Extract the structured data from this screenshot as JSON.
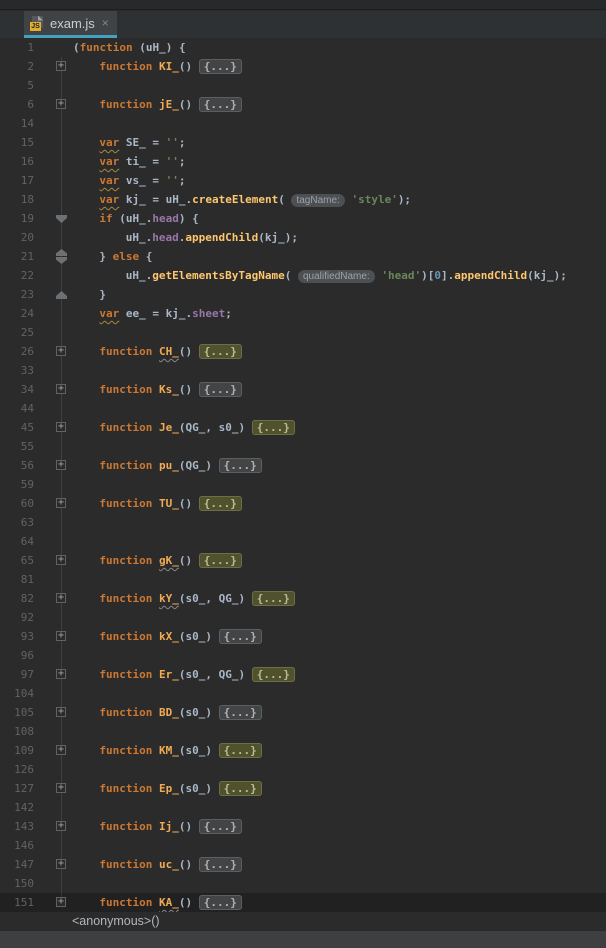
{
  "tab": {
    "title": "exam.js",
    "close_glyph": "×",
    "icon": "js-file-icon",
    "accent_color": "#45a0bd"
  },
  "breadcrumb": {
    "label": "<anonymous>()"
  },
  "colors": {
    "editor_bg": "#2b2b2b",
    "keyword": "#cc7832",
    "function_name": "#f0ab54",
    "method_call": "#ffc66d",
    "string": "#6a8759",
    "number": "#6897bb",
    "field": "#9876aa",
    "fold_highlight_bg": "#4f522d",
    "gutter_text": "#606366"
  },
  "rows": [
    {
      "n": "1",
      "indent": 0,
      "marker": null,
      "segs": [
        [
          "pl",
          "("
        ],
        [
          "kw",
          "function"
        ],
        [
          "pl",
          " (uH_) {"
        ]
      ]
    },
    {
      "n": "2",
      "indent": 4,
      "marker": "plus",
      "segs": [
        [
          "kw",
          "function"
        ],
        [
          "pl",
          " "
        ],
        [
          "fn",
          "KI_"
        ],
        [
          "pl",
          "() "
        ],
        [
          "foldg",
          "{...}"
        ]
      ]
    },
    {
      "n": "5",
      "indent": 0,
      "marker": null,
      "segs": []
    },
    {
      "n": "6",
      "indent": 4,
      "marker": "plus",
      "segs": [
        [
          "kw",
          "function"
        ],
        [
          "pl",
          " "
        ],
        [
          "fn",
          "jE_"
        ],
        [
          "pl",
          "() "
        ],
        [
          "foldg",
          "{...}"
        ]
      ]
    },
    {
      "n": "14",
      "indent": 0,
      "marker": null,
      "segs": []
    },
    {
      "n": "15",
      "indent": 4,
      "marker": null,
      "segs": [
        [
          "kwW",
          "var"
        ],
        [
          "pl",
          " SE_ = "
        ],
        [
          "str",
          "''"
        ],
        [
          "pl",
          ";"
        ]
      ]
    },
    {
      "n": "16",
      "indent": 4,
      "marker": null,
      "segs": [
        [
          "kwW",
          "var"
        ],
        [
          "pl",
          " ti_ = "
        ],
        [
          "str",
          "''"
        ],
        [
          "pl",
          ";"
        ]
      ]
    },
    {
      "n": "17",
      "indent": 4,
      "marker": null,
      "segs": [
        [
          "kwW",
          "var"
        ],
        [
          "pl",
          " vs_ = "
        ],
        [
          "str",
          "''"
        ],
        [
          "pl",
          ";"
        ]
      ]
    },
    {
      "n": "18",
      "indent": 4,
      "marker": null,
      "segs": [
        [
          "kwW",
          "var"
        ],
        [
          "pl",
          " kj_ = uH_."
        ],
        [
          "call",
          "createElement"
        ],
        [
          "pl",
          "( "
        ],
        [
          "hint",
          "tagName:"
        ],
        [
          "pl",
          " "
        ],
        [
          "str",
          "'style'"
        ],
        [
          "pl",
          ");"
        ]
      ]
    },
    {
      "n": "19",
      "indent": 4,
      "marker": "down",
      "segs": [
        [
          "kw",
          "if"
        ],
        [
          "pl",
          " (uH_."
        ],
        [
          "field",
          "head"
        ],
        [
          "pl",
          ") {"
        ]
      ]
    },
    {
      "n": "20",
      "indent": 8,
      "marker": null,
      "segs": [
        [
          "pl",
          "uH_."
        ],
        [
          "field",
          "head"
        ],
        [
          "pl",
          "."
        ],
        [
          "call",
          "appendChild"
        ],
        [
          "pl",
          "(kj_);"
        ]
      ]
    },
    {
      "n": "21",
      "indent": 4,
      "marker": "both",
      "segs": [
        [
          "pl",
          "} "
        ],
        [
          "kw",
          "else"
        ],
        [
          "pl",
          " {"
        ]
      ]
    },
    {
      "n": "22",
      "indent": 8,
      "marker": null,
      "segs": [
        [
          "pl",
          "uH_."
        ],
        [
          "call",
          "getElementsByTagName"
        ],
        [
          "pl",
          "( "
        ],
        [
          "hint",
          "qualifiedName:"
        ],
        [
          "pl",
          " "
        ],
        [
          "str",
          "'head'"
        ],
        [
          "pl",
          ")["
        ],
        [
          "num",
          "0"
        ],
        [
          "pl",
          "]."
        ],
        [
          "call",
          "appendChild"
        ],
        [
          "pl",
          "(kj_);"
        ]
      ]
    },
    {
      "n": "23",
      "indent": 4,
      "marker": "up",
      "segs": [
        [
          "pl",
          "}"
        ]
      ]
    },
    {
      "n": "24",
      "indent": 4,
      "marker": null,
      "segs": [
        [
          "kwW",
          "var"
        ],
        [
          "pl",
          " ee_ = kj_."
        ],
        [
          "field",
          "sheet"
        ],
        [
          "pl",
          ";"
        ]
      ]
    },
    {
      "n": "25",
      "indent": 0,
      "marker": null,
      "segs": []
    },
    {
      "n": "26",
      "indent": 4,
      "marker": "plus",
      "segs": [
        [
          "kw",
          "function"
        ],
        [
          "pl",
          " "
        ],
        [
          "fnW",
          "CH_"
        ],
        [
          "pl",
          "() "
        ],
        [
          "foldo",
          "{...}"
        ]
      ]
    },
    {
      "n": "33",
      "indent": 0,
      "marker": null,
      "segs": []
    },
    {
      "n": "34",
      "indent": 4,
      "marker": "plus",
      "segs": [
        [
          "kw",
          "function"
        ],
        [
          "pl",
          " "
        ],
        [
          "fn",
          "Ks_"
        ],
        [
          "pl",
          "() "
        ],
        [
          "foldg",
          "{...}"
        ]
      ]
    },
    {
      "n": "44",
      "indent": 0,
      "marker": null,
      "segs": []
    },
    {
      "n": "45",
      "indent": 4,
      "marker": "plus",
      "segs": [
        [
          "kw",
          "function"
        ],
        [
          "pl",
          " "
        ],
        [
          "fn",
          "Je_"
        ],
        [
          "pl",
          "(QG_, s0_) "
        ],
        [
          "foldo",
          "{...}"
        ]
      ]
    },
    {
      "n": "55",
      "indent": 0,
      "marker": null,
      "segs": []
    },
    {
      "n": "56",
      "indent": 4,
      "marker": "plus",
      "segs": [
        [
          "kw",
          "function"
        ],
        [
          "pl",
          " "
        ],
        [
          "fn",
          "pu_"
        ],
        [
          "pl",
          "(QG_) "
        ],
        [
          "foldg",
          "{...}"
        ]
      ]
    },
    {
      "n": "59",
      "indent": 0,
      "marker": null,
      "segs": []
    },
    {
      "n": "60",
      "indent": 4,
      "marker": "plus",
      "segs": [
        [
          "kw",
          "function"
        ],
        [
          "pl",
          " "
        ],
        [
          "fn",
          "TU_"
        ],
        [
          "pl",
          "() "
        ],
        [
          "foldo",
          "{...}"
        ]
      ]
    },
    {
      "n": "63",
      "indent": 0,
      "marker": null,
      "segs": []
    },
    {
      "n": "64",
      "indent": 0,
      "marker": null,
      "segs": []
    },
    {
      "n": "65",
      "indent": 4,
      "marker": "plus",
      "segs": [
        [
          "kw",
          "function"
        ],
        [
          "pl",
          " "
        ],
        [
          "fnW",
          "gK_"
        ],
        [
          "pl",
          "() "
        ],
        [
          "foldo",
          "{...}"
        ]
      ]
    },
    {
      "n": "81",
      "indent": 0,
      "marker": null,
      "segs": []
    },
    {
      "n": "82",
      "indent": 4,
      "marker": "plus",
      "segs": [
        [
          "kw",
          "function"
        ],
        [
          "pl",
          " "
        ],
        [
          "fnW",
          "kY_"
        ],
        [
          "pl",
          "(s0_, QG_) "
        ],
        [
          "foldo",
          "{...}"
        ]
      ]
    },
    {
      "n": "92",
      "indent": 0,
      "marker": null,
      "segs": []
    },
    {
      "n": "93",
      "indent": 4,
      "marker": "plus",
      "segs": [
        [
          "kw",
          "function"
        ],
        [
          "pl",
          " "
        ],
        [
          "fn",
          "kX_"
        ],
        [
          "pl",
          "(s0_) "
        ],
        [
          "foldg",
          "{...}"
        ]
      ]
    },
    {
      "n": "96",
      "indent": 0,
      "marker": null,
      "segs": []
    },
    {
      "n": "97",
      "indent": 4,
      "marker": "plus",
      "segs": [
        [
          "kw",
          "function"
        ],
        [
          "pl",
          " "
        ],
        [
          "fn",
          "Er_"
        ],
        [
          "pl",
          "(s0_, QG_) "
        ],
        [
          "foldo",
          "{...}"
        ]
      ]
    },
    {
      "n": "104",
      "indent": 0,
      "marker": null,
      "segs": []
    },
    {
      "n": "105",
      "indent": 4,
      "marker": "plus",
      "segs": [
        [
          "kw",
          "function"
        ],
        [
          "pl",
          " "
        ],
        [
          "fn",
          "BD_"
        ],
        [
          "pl",
          "(s0_) "
        ],
        [
          "foldg",
          "{...}"
        ]
      ]
    },
    {
      "n": "108",
      "indent": 0,
      "marker": null,
      "segs": []
    },
    {
      "n": "109",
      "indent": 4,
      "marker": "plus",
      "segs": [
        [
          "kw",
          "function"
        ],
        [
          "pl",
          " "
        ],
        [
          "fn",
          "KM_"
        ],
        [
          "pl",
          "(s0_) "
        ],
        [
          "foldo",
          "{...}"
        ]
      ]
    },
    {
      "n": "126",
      "indent": 0,
      "marker": null,
      "segs": []
    },
    {
      "n": "127",
      "indent": 4,
      "marker": "plus",
      "segs": [
        [
          "kw",
          "function"
        ],
        [
          "pl",
          " "
        ],
        [
          "fn",
          "Ep_"
        ],
        [
          "pl",
          "(s0_) "
        ],
        [
          "foldo",
          "{...}"
        ]
      ]
    },
    {
      "n": "142",
      "indent": 0,
      "marker": null,
      "segs": []
    },
    {
      "n": "143",
      "indent": 4,
      "marker": "plus",
      "segs": [
        [
          "kw",
          "function"
        ],
        [
          "pl",
          " "
        ],
        [
          "fn",
          "Ij_"
        ],
        [
          "pl",
          "() "
        ],
        [
          "foldg",
          "{...}"
        ]
      ]
    },
    {
      "n": "146",
      "indent": 0,
      "marker": null,
      "segs": []
    },
    {
      "n": "147",
      "indent": 4,
      "marker": "plus",
      "segs": [
        [
          "kw",
          "function"
        ],
        [
          "pl",
          " "
        ],
        [
          "fn",
          "uc_"
        ],
        [
          "pl",
          "() "
        ],
        [
          "foldg",
          "{...}"
        ]
      ]
    },
    {
      "n": "150",
      "indent": 0,
      "marker": null,
      "segs": []
    },
    {
      "n": "151",
      "indent": 4,
      "marker": "plus",
      "dark": true,
      "segs": [
        [
          "kw",
          "function"
        ],
        [
          "pl",
          " "
        ],
        [
          "fnW",
          "KA_"
        ],
        [
          "pl",
          "() "
        ],
        [
          "foldg",
          "{...}"
        ]
      ]
    }
  ]
}
